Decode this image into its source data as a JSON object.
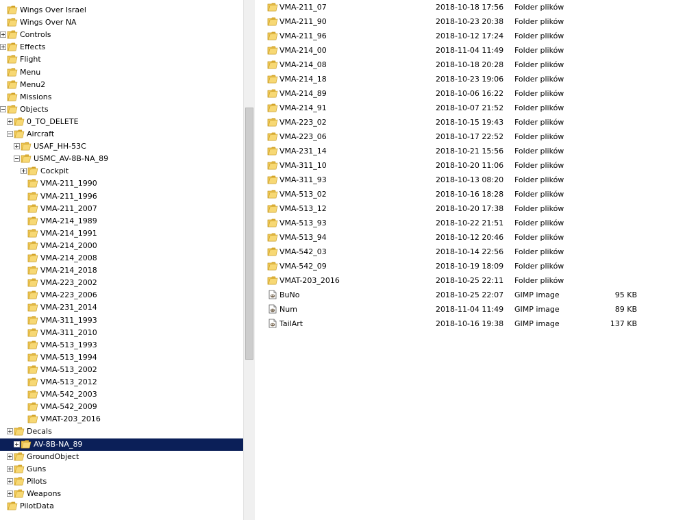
{
  "colors": {
    "selection_background": "#0b1f58",
    "folder_yellow": "#f3cd5b"
  },
  "tree": {
    "items": [
      {
        "label": "Wings Over Israel",
        "expander": "none",
        "selected": false
      },
      {
        "label": "Wings Over NA",
        "expander": "none",
        "selected": false
      },
      {
        "label": "Controls",
        "expander": "plus",
        "selected": false
      },
      {
        "label": "Effects",
        "expander": "plus",
        "selected": false
      },
      {
        "label": "Flight",
        "expander": "none",
        "selected": false
      },
      {
        "label": "Menu",
        "expander": "none",
        "selected": false
      },
      {
        "label": "Menu2",
        "expander": "none",
        "selected": false
      },
      {
        "label": "Missions",
        "expander": "none",
        "selected": false
      },
      {
        "label": "Objects",
        "expander": "minus",
        "selected": false
      },
      {
        "label": "0_TO_DELETE",
        "expander": "plus",
        "selected": false
      },
      {
        "label": "Aircraft",
        "expander": "minus",
        "selected": false
      },
      {
        "label": "USAF_HH-53C",
        "expander": "plus",
        "selected": false
      },
      {
        "label": "USMC_AV-8B-NA_89",
        "expander": "minus",
        "selected": false
      },
      {
        "label": "Cockpit",
        "expander": "plus",
        "selected": false
      },
      {
        "label": "VMA-211_1990",
        "expander": "none",
        "selected": false
      },
      {
        "label": "VMA-211_1996",
        "expander": "none",
        "selected": false
      },
      {
        "label": "VMA-211_2007",
        "expander": "none",
        "selected": false
      },
      {
        "label": "VMA-214_1989",
        "expander": "none",
        "selected": false
      },
      {
        "label": "VMA-214_1991",
        "expander": "none",
        "selected": false
      },
      {
        "label": "VMA-214_2000",
        "expander": "none",
        "selected": false
      },
      {
        "label": "VMA-214_2008",
        "expander": "none",
        "selected": false
      },
      {
        "label": "VMA-214_2018",
        "expander": "none",
        "selected": false
      },
      {
        "label": "VMA-223_2002",
        "expander": "none",
        "selected": false
      },
      {
        "label": "VMA-223_2006",
        "expander": "none",
        "selected": false
      },
      {
        "label": "VMA-231_2014",
        "expander": "none",
        "selected": false
      },
      {
        "label": "VMA-311_1993",
        "expander": "none",
        "selected": false
      },
      {
        "label": "VMA-311_2010",
        "expander": "none",
        "selected": false
      },
      {
        "label": "VMA-513_1993",
        "expander": "none",
        "selected": false
      },
      {
        "label": "VMA-513_1994",
        "expander": "none",
        "selected": false
      },
      {
        "label": "VMA-513_2002",
        "expander": "none",
        "selected": false
      },
      {
        "label": "VMA-513_2012",
        "expander": "none",
        "selected": false
      },
      {
        "label": "VMA-542_2003",
        "expander": "none",
        "selected": false
      },
      {
        "label": "VMA-542_2009",
        "expander": "none",
        "selected": false
      },
      {
        "label": "VMAT-203_2016",
        "expander": "none",
        "selected": false
      },
      {
        "label": "Decals",
        "expander": "plus",
        "selected": false
      },
      {
        "label": "AV-8B-NA_89",
        "expander": "plus",
        "selected": true
      },
      {
        "label": "GroundObject",
        "expander": "plus",
        "selected": false
      },
      {
        "label": "Guns",
        "expander": "plus",
        "selected": false
      },
      {
        "label": "Pilots",
        "expander": "plus",
        "selected": false
      },
      {
        "label": "Weapons",
        "expander": "plus",
        "selected": false
      },
      {
        "label": "PilotData",
        "expander": "none",
        "selected": false
      }
    ]
  },
  "file_list": {
    "rows": [
      {
        "name": "VMA-211_07",
        "date": "2018-10-18 17:56",
        "type": "Folder plików",
        "size": "",
        "icon": "folder-icon"
      },
      {
        "name": "VMA-211_90",
        "date": "2018-10-23 20:38",
        "type": "Folder plików",
        "size": "",
        "icon": "folder-icon"
      },
      {
        "name": "VMA-211_96",
        "date": "2018-10-12 17:24",
        "type": "Folder plików",
        "size": "",
        "icon": "folder-icon"
      },
      {
        "name": "VMA-214_00",
        "date": "2018-11-04 11:49",
        "type": "Folder plików",
        "size": "",
        "icon": "folder-icon"
      },
      {
        "name": "VMA-214_08",
        "date": "2018-10-18 20:28",
        "type": "Folder plików",
        "size": "",
        "icon": "folder-icon"
      },
      {
        "name": "VMA-214_18",
        "date": "2018-10-23 19:06",
        "type": "Folder plików",
        "size": "",
        "icon": "folder-icon"
      },
      {
        "name": "VMA-214_89",
        "date": "2018-10-06 16:22",
        "type": "Folder plików",
        "size": "",
        "icon": "folder-icon"
      },
      {
        "name": "VMA-214_91",
        "date": "2018-10-07 21:52",
        "type": "Folder plików",
        "size": "",
        "icon": "folder-icon"
      },
      {
        "name": "VMA-223_02",
        "date": "2018-10-15 19:43",
        "type": "Folder plików",
        "size": "",
        "icon": "folder-icon"
      },
      {
        "name": "VMA-223_06",
        "date": "2018-10-17 22:52",
        "type": "Folder plików",
        "size": "",
        "icon": "folder-icon"
      },
      {
        "name": "VMA-231_14",
        "date": "2018-10-21 15:56",
        "type": "Folder plików",
        "size": "",
        "icon": "folder-icon"
      },
      {
        "name": "VMA-311_10",
        "date": "2018-10-20 11:06",
        "type": "Folder plików",
        "size": "",
        "icon": "folder-icon"
      },
      {
        "name": "VMA-311_93",
        "date": "2018-10-13 08:20",
        "type": "Folder plików",
        "size": "",
        "icon": "folder-icon"
      },
      {
        "name": "VMA-513_02",
        "date": "2018-10-16 18:28",
        "type": "Folder plików",
        "size": "",
        "icon": "folder-icon"
      },
      {
        "name": "VMA-513_12",
        "date": "2018-10-20 17:38",
        "type": "Folder plików",
        "size": "",
        "icon": "folder-icon"
      },
      {
        "name": "VMA-513_93",
        "date": "2018-10-22 21:51",
        "type": "Folder plików",
        "size": "",
        "icon": "folder-icon"
      },
      {
        "name": "VMA-513_94",
        "date": "2018-10-12 20:46",
        "type": "Folder plików",
        "size": "",
        "icon": "folder-icon"
      },
      {
        "name": "VMA-542_03",
        "date": "2018-10-14 22:56",
        "type": "Folder plików",
        "size": "",
        "icon": "folder-icon"
      },
      {
        "name": "VMA-542_09",
        "date": "2018-10-19 18:09",
        "type": "Folder plików",
        "size": "",
        "icon": "folder-icon"
      },
      {
        "name": "VMAT-203_2016",
        "date": "2018-10-25 22:11",
        "type": "Folder plików",
        "size": "",
        "icon": "folder-icon"
      },
      {
        "name": "BuNo",
        "date": "2018-10-25 22:07",
        "type": "GIMP image",
        "size": "95 KB",
        "icon": "gimp-image-icon"
      },
      {
        "name": "Num",
        "date": "2018-11-04 11:49",
        "type": "GIMP image",
        "size": "89 KB",
        "icon": "gimp-image-icon"
      },
      {
        "name": "TailArt",
        "date": "2018-10-16 19:38",
        "type": "GIMP image",
        "size": "137 KB",
        "icon": "gimp-image-icon"
      }
    ]
  }
}
